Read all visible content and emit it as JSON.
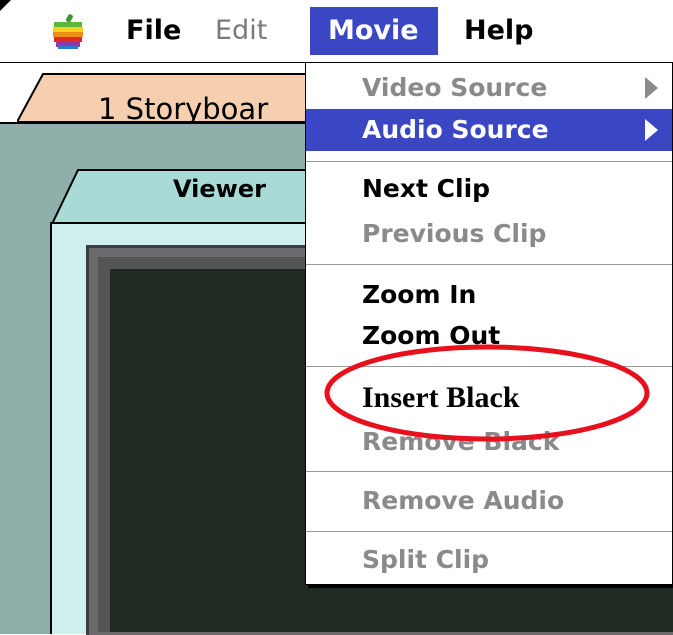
{
  "menubar": {
    "items": [
      {
        "label": "File"
      },
      {
        "label": "Edit"
      },
      {
        "label": "Movie"
      },
      {
        "label": "Help"
      }
    ]
  },
  "windows": {
    "storyboard_tab": "1 Storyboar",
    "viewer_tab": "Viewer"
  },
  "movie_menu": {
    "items": [
      {
        "label": "Video Source",
        "enabled": false,
        "submenu": true
      },
      {
        "label": "Audio Source",
        "enabled": true,
        "submenu": true,
        "selected": true
      },
      {
        "label": "Next Clip",
        "enabled": true
      },
      {
        "label": "Previous Clip",
        "enabled": false
      },
      {
        "label": "Zoom In",
        "enabled": true
      },
      {
        "label": "Zoom Out",
        "enabled": true
      },
      {
        "label": "Insert Black",
        "enabled": true
      },
      {
        "label": "Remove Black",
        "enabled": false
      },
      {
        "label": "Remove Audio",
        "enabled": false
      },
      {
        "label": "Split Clip",
        "enabled": false
      }
    ]
  },
  "colors": {
    "selection": "#3a46c4",
    "highlight_ellipse": "#e8101c",
    "window_teal": "#8fb0aa",
    "storyboard_tab": "#f6cfb0"
  }
}
